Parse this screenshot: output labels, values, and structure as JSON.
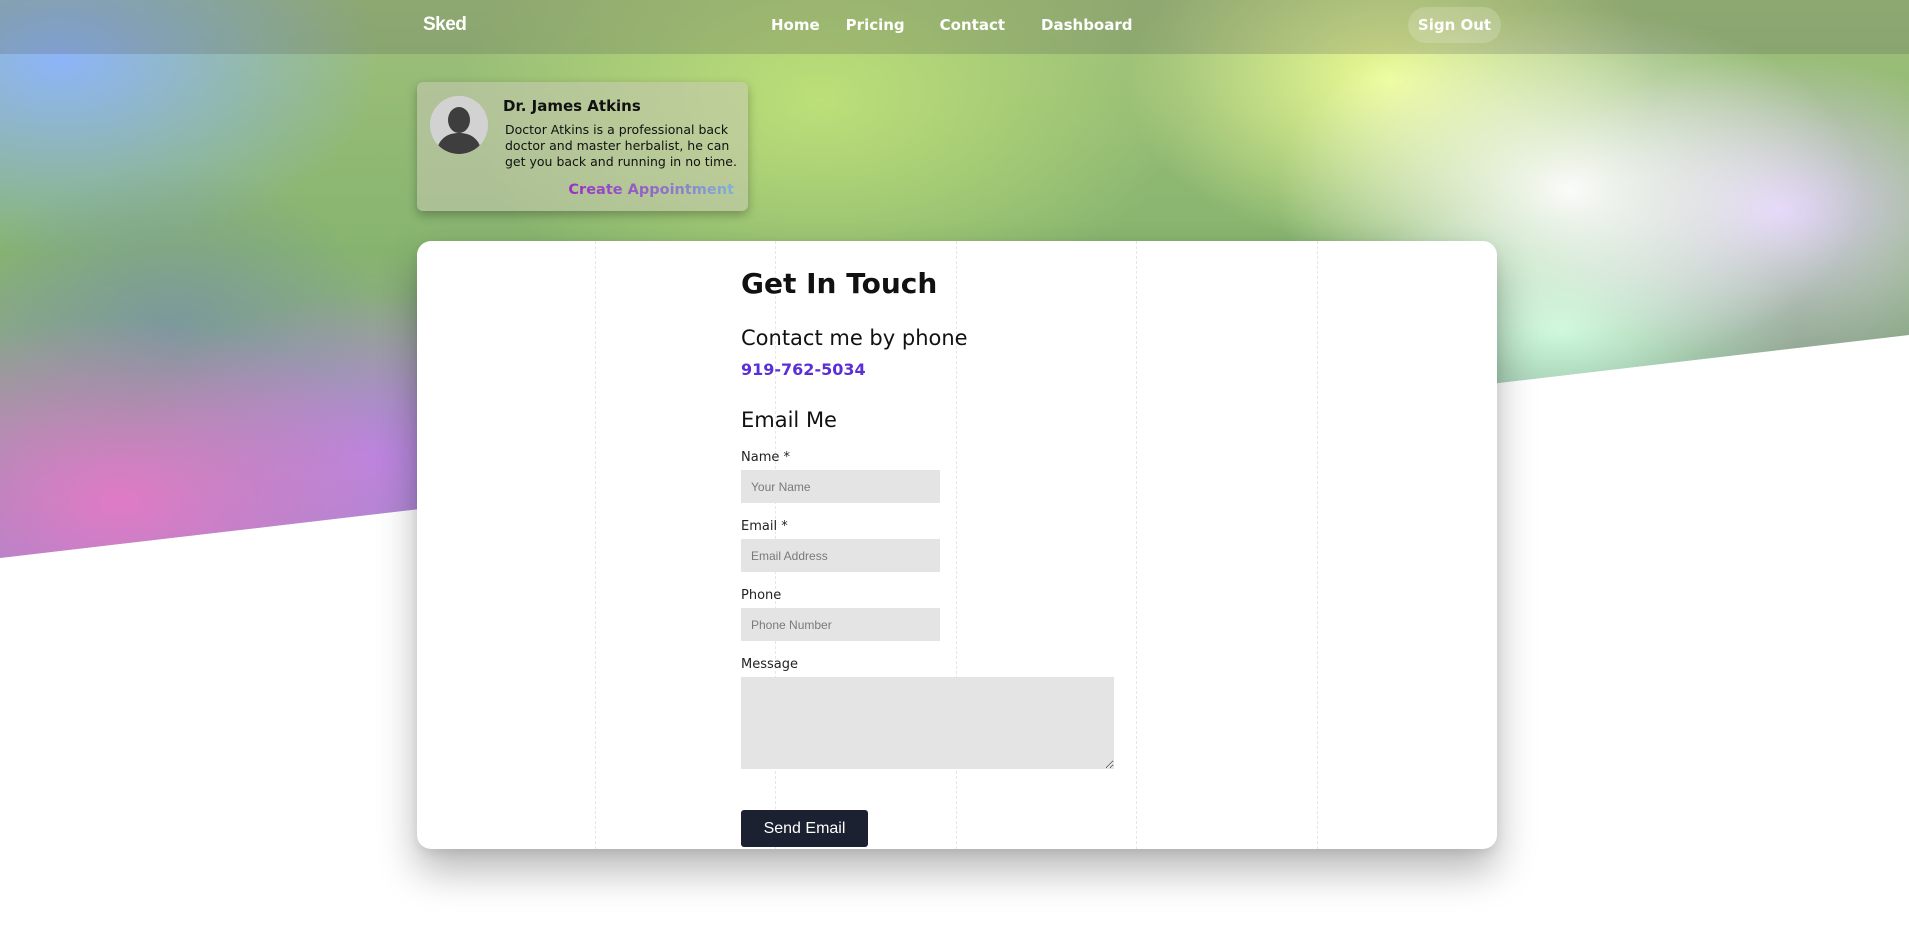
{
  "nav": {
    "brand": "Sked",
    "links": [
      "Home",
      "Pricing",
      "Contact",
      "Dashboard"
    ],
    "sign_out": "Sign Out"
  },
  "doctor": {
    "name": "Dr. James Atkins",
    "bio": "Doctor Atkins is a professional back doctor and master herbalist, he can get you back and running in no time.",
    "cta": "Create Appointment"
  },
  "contact": {
    "title": "Get In Touch",
    "phone_heading": "Contact me by phone",
    "phone_number": "919-762-5034",
    "email_heading": "Email Me",
    "form": {
      "name_label": "Name *",
      "name_placeholder": "Your Name",
      "email_label": "Email *",
      "email_placeholder": "Email Address",
      "phone_label": "Phone",
      "phone_placeholder": "Phone Number",
      "message_label": "Message",
      "submit": "Send Email"
    }
  },
  "colors": {
    "accent": "#5b2fd6",
    "button": "#1b2131",
    "input_bg": "#e4e4e4"
  }
}
